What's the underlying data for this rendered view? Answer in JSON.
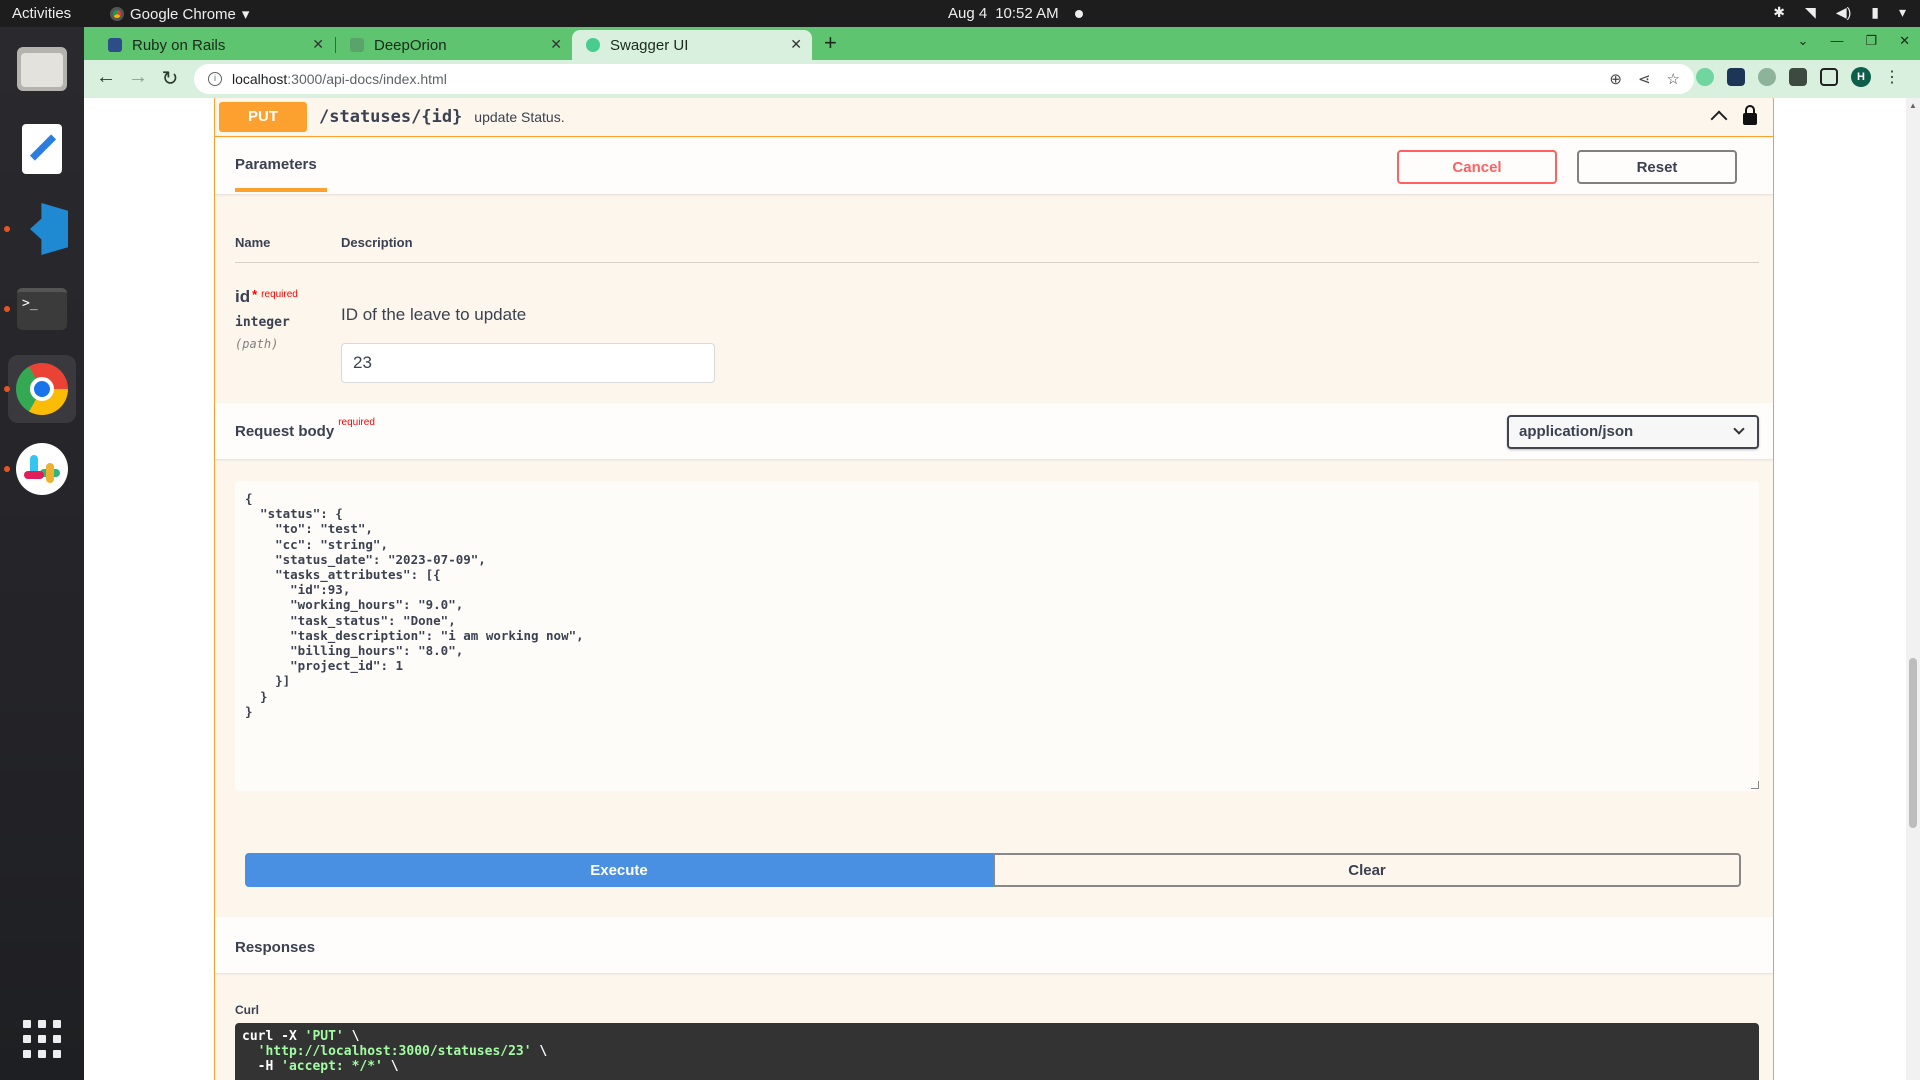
{
  "topbar": {
    "activities": "Activities",
    "app_name": "Google Chrome",
    "date": "Aug 4",
    "time": "10:52 AM"
  },
  "browser": {
    "tabs": [
      {
        "title": "Ruby on Rails",
        "favicon_color": "#2d4d8a"
      },
      {
        "title": "DeepOrion",
        "favicon_color": "#5aa36a"
      },
      {
        "title": "Swagger UI",
        "favicon_color": "#49cc90",
        "active": true
      }
    ],
    "url_host": "localhost",
    "url_path": ":3000/api-docs/index.html",
    "avatar_letter": "H"
  },
  "operation": {
    "method": "PUT",
    "path": "/statuses/{id}",
    "summary": "update Status.",
    "tab_label": "Parameters",
    "cancel_label": "Cancel",
    "reset_label": "Reset",
    "table_headers": {
      "name": "Name",
      "description": "Description"
    },
    "param": {
      "name": "id",
      "star": "*",
      "required": "required",
      "type": "integer",
      "location": "(path)",
      "description": "ID of the leave to update",
      "value": "23"
    },
    "request_body": {
      "title": "Request body",
      "required": "required",
      "content_type": "application/json",
      "json": "{\n  \"status\": {\n    \"to\": \"test\",\n    \"cc\": \"string\",\n    \"status_date\": \"2023-07-09\",\n    \"tasks_attributes\": [{\n      \"id\":93,\n      \"working_hours\": \"9.0\",\n      \"task_status\": \"Done\",\n      \"task_description\": \"i am working now\",\n      \"billing_hours\": \"8.0\",\n      \"project_id\": 1\n    }]\n  }\n}"
    },
    "execute_label": "Execute",
    "clear_label": "Clear",
    "responses_title": "Responses",
    "curl_label": "Curl",
    "curl_lines": [
      {
        "pre": "curl -X ",
        "str": "'PUT'",
        "post": " \\"
      },
      {
        "pre": "  ",
        "str": "'http://localhost:3000/statuses/23'",
        "post": " \\"
      },
      {
        "pre": "  -H ",
        "str": "'accept: */*'",
        "post": " \\"
      }
    ]
  },
  "colors": {
    "put_accent": "#fca130",
    "execute_blue": "#4990e2",
    "cancel_red": "#ff6060",
    "chrome_tab_green": "#5ec46f"
  }
}
